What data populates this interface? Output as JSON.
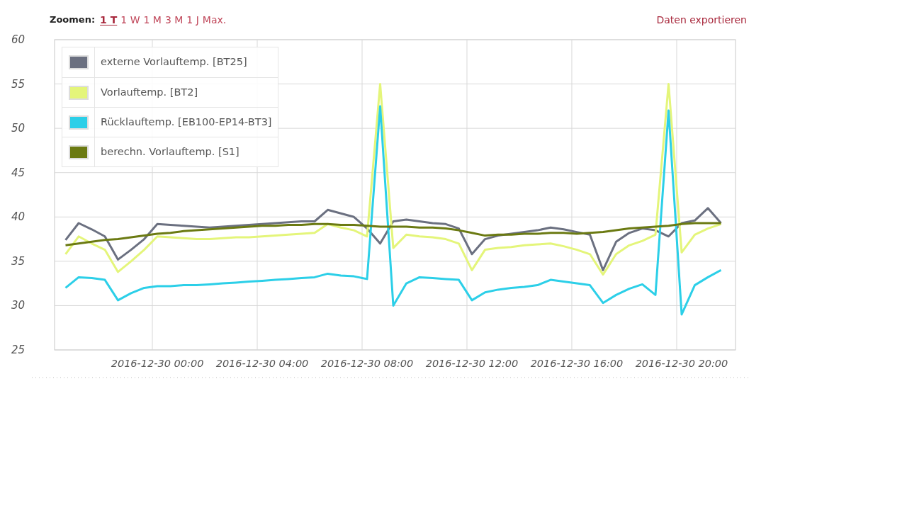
{
  "toolbar": {
    "zoom_label": "Zoomen:",
    "zoom_options": [
      {
        "label": "1 T",
        "selected": true
      },
      {
        "label": "1 W",
        "selected": false
      },
      {
        "label": "1 M",
        "selected": false
      },
      {
        "label": "3 M",
        "selected": false
      },
      {
        "label": "1 J",
        "selected": false
      },
      {
        "label": "Max.",
        "selected": false
      }
    ],
    "export_link": "Daten exportieren"
  },
  "chart": {
    "chart_data": {
      "type": "line",
      "grid": true,
      "legend": true,
      "ylim": [
        25,
        60
      ],
      "yticks": [
        25,
        30,
        35,
        40,
        45,
        50,
        55,
        60
      ],
      "categories": [
        null,
        null,
        null,
        null,
        null,
        null,
        null,
        "2016-12-30 00:00",
        null,
        null,
        null,
        null,
        null,
        null,
        null,
        "2016-12-30 04:00",
        null,
        null,
        null,
        null,
        null,
        null,
        null,
        "2016-12-30 08:00",
        null,
        null,
        null,
        null,
        null,
        null,
        null,
        "2016-12-30 12:00",
        null,
        null,
        null,
        null,
        null,
        null,
        null,
        "2016-12-30 16:00",
        null,
        null,
        null,
        null,
        null,
        null,
        null,
        "2016-12-30 20:00",
        null,
        null,
        null
      ],
      "series": [
        {
          "name": "externe Vorlauftemp. [BT25]",
          "color": "#6b7080",
          "values": [
            37.4,
            39.3,
            38.6,
            37.8,
            35.2,
            36.3,
            37.5,
            39.2,
            39.1,
            39,
            38.9,
            38.8,
            38.9,
            39,
            39.1,
            39.2,
            39.3,
            39.4,
            39.5,
            39.5,
            40.8,
            40.4,
            40,
            38.7,
            37,
            39.5,
            39.7,
            39.5,
            39.3,
            39.2,
            38.7,
            35.8,
            37.5,
            37.9,
            38.1,
            38.3,
            38.5,
            38.8,
            38.6,
            38.3,
            38,
            34,
            37.2,
            38.2,
            38.7,
            38.5,
            37.8,
            39.3,
            39.6,
            41,
            39.3
          ]
        },
        {
          "name": "Vorlauftemp. [BT2]",
          "color": "#e4f57a",
          "values": [
            35.8,
            37.8,
            37,
            36.3,
            33.8,
            35,
            36.3,
            37.8,
            37.7,
            37.6,
            37.5,
            37.5,
            37.6,
            37.7,
            37.7,
            37.8,
            37.9,
            38,
            38.1,
            38.2,
            39.2,
            38.8,
            38.5,
            37.8,
            55,
            36.5,
            38,
            37.8,
            37.7,
            37.5,
            37,
            34,
            36.3,
            36.5,
            36.6,
            36.8,
            36.9,
            37,
            36.7,
            36.3,
            35.8,
            33.5,
            35.8,
            36.8,
            37.3,
            38,
            55,
            36,
            38,
            38.7,
            39.2
          ]
        },
        {
          "name": "Rücklauftemp. [EB100-EP14-BT3]",
          "color": "#2ccfe8",
          "values": [
            32,
            33.2,
            33.1,
            32.9,
            30.6,
            31.4,
            32,
            32.2,
            32.2,
            32.3,
            32.3,
            32.4,
            32.5,
            32.6,
            32.7,
            32.8,
            32.9,
            33,
            33.1,
            33.2,
            33.6,
            33.4,
            33.3,
            33,
            52.5,
            30,
            32.5,
            33.2,
            33.1,
            33,
            32.9,
            30.6,
            31.5,
            31.8,
            32,
            32.1,
            32.3,
            32.9,
            32.7,
            32.5,
            32.3,
            30.3,
            31.2,
            31.9,
            32.4,
            31.2,
            52,
            29,
            32.3,
            33.2,
            34
          ]
        },
        {
          "name": "berechn. Vorlauftemp. [S1]",
          "color": "#6b7a12",
          "values": [
            36.8,
            37,
            37.2,
            37.4,
            37.5,
            37.7,
            37.9,
            38.1,
            38.2,
            38.4,
            38.5,
            38.6,
            38.7,
            38.8,
            38.9,
            39,
            39,
            39.1,
            39.1,
            39.2,
            39.2,
            39.1,
            39.1,
            39,
            38.9,
            38.9,
            38.9,
            38.8,
            38.8,
            38.7,
            38.5,
            38.2,
            37.9,
            38,
            38,
            38.1,
            38.1,
            38.2,
            38.2,
            38.1,
            38.2,
            38.3,
            38.5,
            38.7,
            38.8,
            38.9,
            39,
            39.2,
            39.3,
            39.3,
            39.3
          ]
        }
      ]
    }
  }
}
